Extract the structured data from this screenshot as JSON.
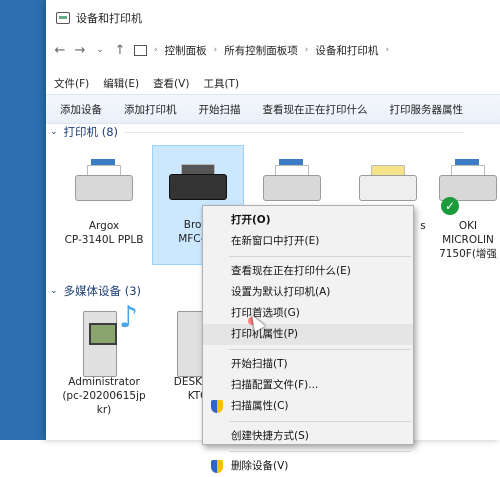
{
  "window": {
    "title": "设备和打印机"
  },
  "address": {
    "parts": [
      "控制面板",
      "所有控制面板项",
      "设备和打印机"
    ]
  },
  "menu": [
    "文件(F)",
    "编辑(E)",
    "查看(V)",
    "工具(T)"
  ],
  "toolbar": [
    "添加设备",
    "添加打印机",
    "开始扫描",
    "查看现在正在打印什么",
    "打印服务器属性"
  ],
  "groups": {
    "printers": "打印机 (8)",
    "media": "多媒体设备 (3)"
  },
  "printers": [
    {
      "line1": "Argox",
      "line2": "CP-3140L PPLB"
    },
    {
      "line1": "Broth",
      "line2": "MFC-78"
    },
    {
      "line1": "",
      "line2": ""
    },
    {
      "line1": "",
      "line2": "s"
    },
    {
      "line1": "OKI",
      "line2": "MICROLIN",
      "line3": "7150F(增强"
    }
  ],
  "media": [
    {
      "line1": "Administrator",
      "line2": "(pc-20200615jp",
      "line3": "kr)"
    },
    {
      "line1": "DESKTOP",
      "line2": "KTG"
    }
  ],
  "context_menu": [
    "打开(O)",
    "在新窗口中打开(E)",
    "查看现在正在打印什么(E)",
    "设置为默认打印机(A)",
    "打印首选项(G)",
    "打印机属性(P)",
    "开始扫描(T)",
    "扫描配置文件(F)...",
    "扫描属性(C)",
    "创建快捷方式(S)",
    "删除设备(V)"
  ]
}
